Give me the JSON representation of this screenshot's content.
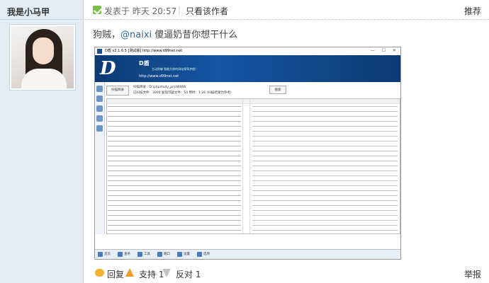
{
  "author": {
    "name": "我是小马甲"
  },
  "post": {
    "time": "发表于 昨天 20:57",
    "separator": "|",
    "only_author": "只看该作者",
    "floor": "推荐",
    "text_before": "狗贼，",
    "mention": "@naixi",
    "text_after": " 傻逼奶昔你想干什么"
  },
  "screenshot": {
    "window_title": "D盾 v2.1.6.5 [测试版] http://www.d99net.net",
    "window_controls": "— ☐ ✕",
    "logo": "D",
    "brand": "D盾",
    "tagline": "主动防御  智能为你的网站保驾护航!",
    "site": "http://www.d99net.net",
    "scan_button": "扫描目录",
    "scan_line1": "扫描目录：D:\\phpstudy_pro\\WWW",
    "scan_line2": "已扫描文件：3000  发现可疑文件：54  用时：1:26  (扫描结果为参考)",
    "search_button": "搜索",
    "bottom_tabs": [
      "首页",
      "查杀",
      "工具",
      "端口",
      "设置",
      "选项"
    ]
  },
  "footer": {
    "reply": "回复",
    "support": "支持 1",
    "oppose": "反对 1",
    "report": "举报"
  },
  "colors": {
    "author_bg": "#e5edf2",
    "border": "#c2d5e3",
    "mention": "#336699",
    "banner": "#1555a3",
    "support": "#f09a2a"
  }
}
